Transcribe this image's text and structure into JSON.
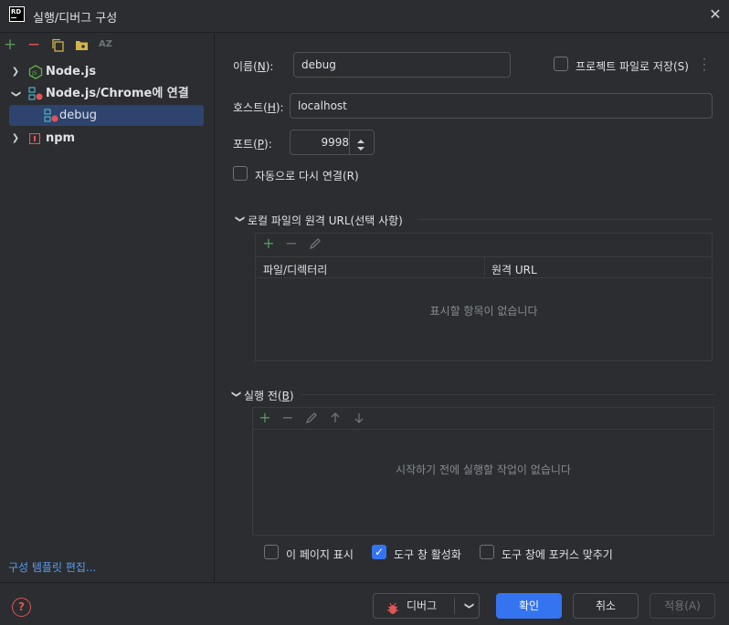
{
  "window": {
    "title": "실행/디버그 구성",
    "logo": "RD"
  },
  "left_toolbar": {
    "icons": [
      "add-icon",
      "remove-icon",
      "copy-icon",
      "folder-add-icon",
      "sort-az-icon"
    ],
    "sort_label": "AZ"
  },
  "tree": {
    "items": [
      {
        "label": "Node.js",
        "icon": "nodejs-icon"
      },
      {
        "label": "Node.js/Chrome에 연결",
        "icon": "chrome-debug-icon"
      },
      {
        "label": "debug",
        "icon": "chrome-debug-icon"
      },
      {
        "label": "npm",
        "icon": "npm-icon"
      }
    ]
  },
  "template_link": "구성 템플릿 편집...",
  "form": {
    "name_label": "이름(",
    "name_mnemonic": "N",
    "name_label_end": "):",
    "name_value": "debug",
    "store_label": "프로젝트 파일로 저장(S)",
    "host_label": "호스트(",
    "host_mnemonic": "H",
    "host_label_end": "):",
    "host_value": "localhost",
    "port_label": "포트(",
    "port_mnemonic": "P",
    "port_label_end": "):",
    "port_value": "9998",
    "reconnect_label": "자동으로 다시 연결(R)"
  },
  "remote_urls": {
    "title": "로컬 파일의 원격 URL(선택 사항)",
    "col_file": "파일/디렉터리",
    "col_url": "원격 URL",
    "empty": "표시할 항목이 없습니다"
  },
  "before_launch": {
    "title_pre": "실행 전(",
    "mnemonic": "B",
    "title_post": ")",
    "empty": "시작하기 전에 실행할 작업이 없습니다"
  },
  "options": {
    "show_page": "이 페이지 표시",
    "activate_tool": "도구 창 활성화",
    "focus_tool": "도구 창에 포커스 맞추기"
  },
  "buttons": {
    "debug": "디버그",
    "ok": "확인",
    "cancel": "취소",
    "apply": "적용(A)"
  },
  "colors": {
    "accent": "#3574f0",
    "selection": "#2e436e",
    "link": "#589df6",
    "add": "#57965c",
    "remove": "#e05555"
  }
}
